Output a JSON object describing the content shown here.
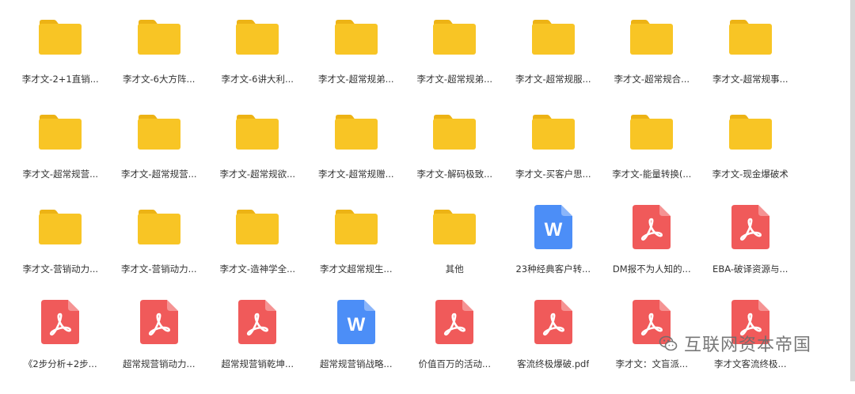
{
  "colors": {
    "folder": "#F8C525",
    "folder_tab": "#EDB315",
    "pdf": "#F05A5A",
    "word": "#4C8EF7",
    "text": "#333333",
    "watermark": "#6D6D6D"
  },
  "items": [
    {
      "type": "folder",
      "icon": "folder-icon",
      "label": "李才文-2+1直销..."
    },
    {
      "type": "folder",
      "icon": "folder-icon",
      "label": "李才文-6大方阵..."
    },
    {
      "type": "folder",
      "icon": "folder-icon",
      "label": "李才文-6讲大利..."
    },
    {
      "type": "folder",
      "icon": "folder-icon",
      "label": "李才文-超常规弟..."
    },
    {
      "type": "folder",
      "icon": "folder-icon",
      "label": "李才文-超常规弟..."
    },
    {
      "type": "folder",
      "icon": "folder-icon",
      "label": "李才文-超常规服..."
    },
    {
      "type": "folder",
      "icon": "folder-icon",
      "label": "李才文-超常规合..."
    },
    {
      "type": "folder",
      "icon": "folder-icon",
      "label": "李才文-超常规事..."
    },
    {
      "type": "folder",
      "icon": "folder-icon",
      "label": "李才文-超常规营..."
    },
    {
      "type": "folder",
      "icon": "folder-icon",
      "label": "李才文-超常规营..."
    },
    {
      "type": "folder",
      "icon": "folder-icon",
      "label": "李才文-超常规欲..."
    },
    {
      "type": "folder",
      "icon": "folder-icon",
      "label": "李才文-超常规赠..."
    },
    {
      "type": "folder",
      "icon": "folder-icon",
      "label": "李才文-解码极致..."
    },
    {
      "type": "folder",
      "icon": "folder-icon",
      "label": "李才文-买客户思..."
    },
    {
      "type": "folder",
      "icon": "folder-icon",
      "label": "李才文-能量转换(..."
    },
    {
      "type": "folder",
      "icon": "folder-icon",
      "label": "李才文-现金爆破术"
    },
    {
      "type": "folder",
      "icon": "folder-icon",
      "label": "李才文-营销动力..."
    },
    {
      "type": "folder",
      "icon": "folder-icon",
      "label": "李才文-营销动力..."
    },
    {
      "type": "folder",
      "icon": "folder-icon",
      "label": "李才文-造神学全..."
    },
    {
      "type": "folder",
      "icon": "folder-icon",
      "label": "李才文超常规生..."
    },
    {
      "type": "folder",
      "icon": "folder-icon",
      "label": "其他"
    },
    {
      "type": "word",
      "icon": "word-doc-icon",
      "glyph": "W",
      "label": "23种经典客户转..."
    },
    {
      "type": "pdf",
      "icon": "pdf-icon",
      "label": "DM报不为人知的..."
    },
    {
      "type": "pdf",
      "icon": "pdf-icon",
      "label": "EBA-破译资源与..."
    },
    {
      "type": "pdf",
      "icon": "pdf-icon",
      "label": "《2步分析+2步..."
    },
    {
      "type": "pdf",
      "icon": "pdf-icon",
      "label": "超常规营销动力..."
    },
    {
      "type": "pdf",
      "icon": "pdf-icon",
      "label": "超常规营销乾坤..."
    },
    {
      "type": "word",
      "icon": "word-doc-icon",
      "glyph": "W",
      "label": "超常规营销战略..."
    },
    {
      "type": "pdf",
      "icon": "pdf-icon",
      "label": "价值百万的活动..."
    },
    {
      "type": "pdf",
      "icon": "pdf-icon",
      "label": "客流终极爆破.pdf"
    },
    {
      "type": "pdf",
      "icon": "pdf-icon",
      "label": "李才文：文盲派..."
    },
    {
      "type": "pdf",
      "icon": "pdf-icon",
      "label": "李才文客流终极..."
    }
  ],
  "watermark": {
    "icon": "wechat-logo-icon",
    "text": "互联网资本帝国"
  }
}
